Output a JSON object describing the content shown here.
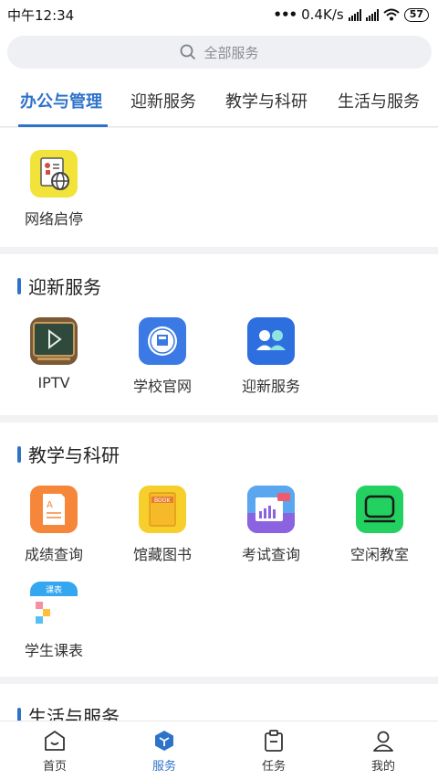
{
  "status": {
    "time": "中午12:34",
    "net_speed": "0.4K/s",
    "battery": "57"
  },
  "search": {
    "placeholder": "全部服务"
  },
  "tabs": [
    {
      "label": "办公与管理",
      "active": true
    },
    {
      "label": "迎新服务",
      "active": false
    },
    {
      "label": "教学与科研",
      "active": false
    },
    {
      "label": "生活与服务",
      "active": false
    }
  ],
  "office": {
    "items": [
      {
        "label": "网络启停",
        "icon": "network-toggle-icon"
      }
    ]
  },
  "welcome": {
    "title": "迎新服务",
    "items": [
      {
        "label": "IPTV",
        "icon": "iptv-play-icon"
      },
      {
        "label": "学校官网",
        "icon": "school-website-icon"
      },
      {
        "label": "迎新服务",
        "icon": "welcome-service-icon"
      }
    ]
  },
  "teaching": {
    "title": "教学与科研",
    "items": [
      {
        "label": "成绩查询",
        "icon": "grade-query-icon"
      },
      {
        "label": "馆藏图书",
        "icon": "library-book-icon"
      },
      {
        "label": "考试查询",
        "icon": "exam-query-icon"
      },
      {
        "label": "空闲教室",
        "icon": "free-classroom-icon"
      },
      {
        "label": "学生课表",
        "icon": "timetable-icon"
      }
    ],
    "timetable_badge": "课表",
    "book_badge": "BOOK"
  },
  "life": {
    "title": "生活与服务"
  },
  "nav": [
    {
      "label": "首页",
      "icon": "home-icon",
      "active": false
    },
    {
      "label": "服务",
      "icon": "service-icon",
      "active": true
    },
    {
      "label": "任务",
      "icon": "task-icon",
      "active": false
    },
    {
      "label": "我的",
      "icon": "profile-icon",
      "active": false
    }
  ],
  "colors": {
    "accent": "#2f73c9"
  }
}
